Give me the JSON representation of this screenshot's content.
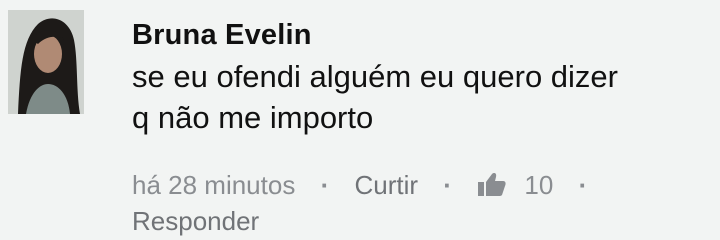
{
  "comment": {
    "author": "Bruna Evelin",
    "text": "se eu ofendi alguém eu quero dizer\nq não me importo",
    "time": "há 28 minutos",
    "like_label": "Curtir",
    "like_count": "10",
    "reply_label": "Responder",
    "separator": "·"
  },
  "icons": {
    "like": "thumbs-up-icon"
  },
  "colors": {
    "background": "#f2f4f3",
    "text": "#111111",
    "meta": "#8a8d91"
  }
}
